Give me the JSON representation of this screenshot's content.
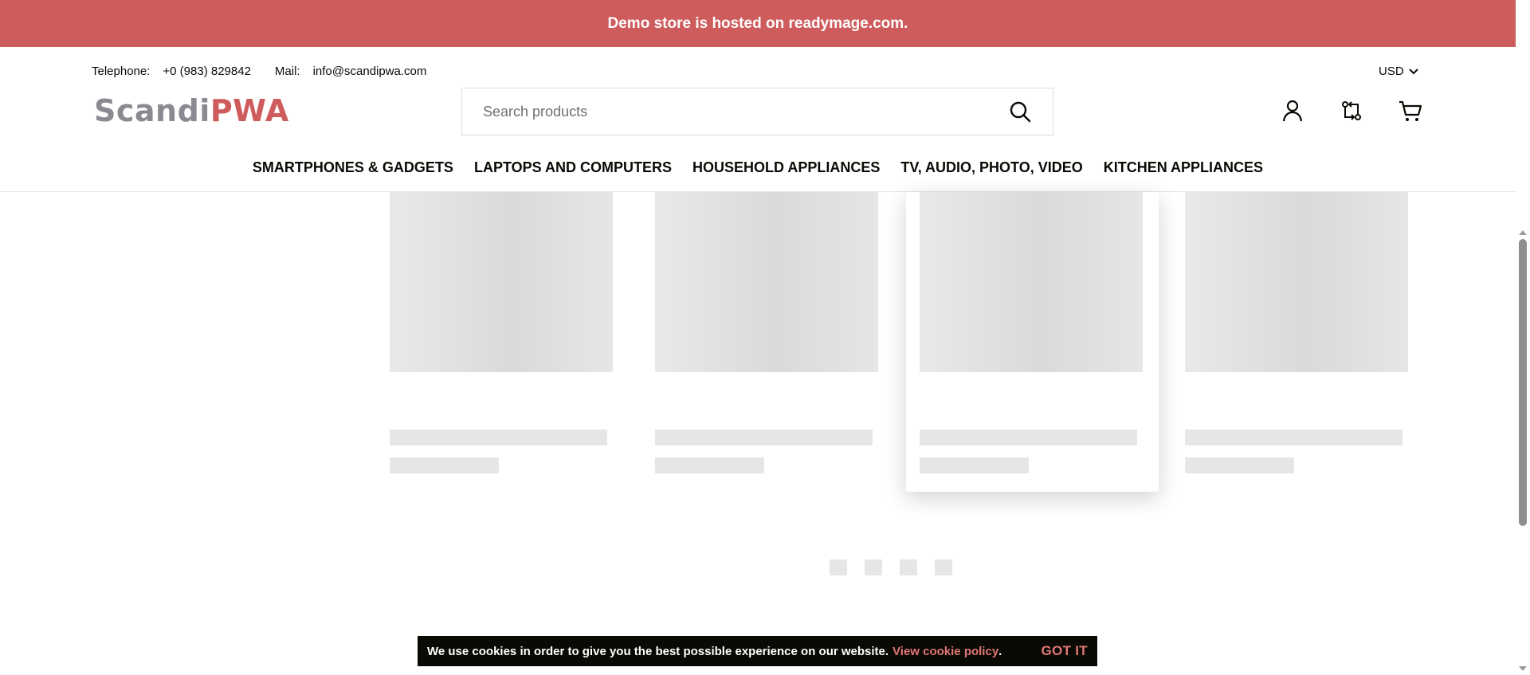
{
  "banner": {
    "text": "Demo store is hosted on readymage.com."
  },
  "contact": {
    "phone_label": "Telephone:",
    "phone_value": "+0 (983) 829842",
    "mail_label": "Mail:",
    "mail_value": "info@scandipwa.com"
  },
  "currency": {
    "value": "USD",
    "icon": "chevron-down-icon"
  },
  "logo": {
    "part1": "Scandi",
    "part2": "PWA"
  },
  "search": {
    "placeholder": "Search products",
    "value": "",
    "icon": "search-icon"
  },
  "header_icons": [
    "account-icon",
    "compare-icon",
    "cart-icon"
  ],
  "nav": {
    "items": [
      "SMARTPHONES & GADGETS",
      "LAPTOPS AND COMPUTERS",
      "HOUSEHOLD APPLIANCES",
      "TV, AUDIO, PHOTO, VIDEO",
      "KITCHEN APPLIANCES"
    ]
  },
  "products": {
    "placeholder_cards": 4,
    "active_card_number": 3
  },
  "slider": {
    "pages": 4
  },
  "cookie": {
    "message": "We use cookies in order to give you the best possible experience on our website.",
    "link": "View cookie policy",
    "period": ".",
    "accept": "GOT IT"
  },
  "colors": {
    "brand": "#cf5c5c",
    "link": "#e27777",
    "text": "#0a0903",
    "placeholder": "#e6e6e6"
  }
}
